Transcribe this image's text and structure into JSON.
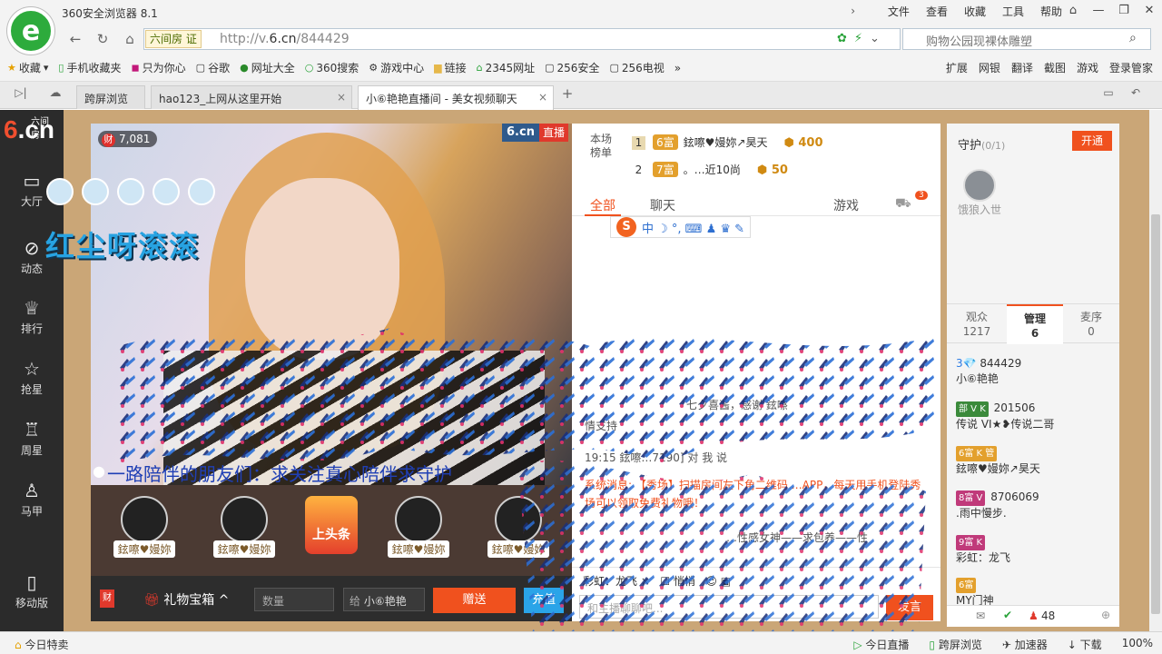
{
  "browser": {
    "app_title": "360安全浏览器 8.1",
    "menus": [
      "文件",
      "查看",
      "收藏",
      "工具",
      "帮助"
    ],
    "site_chip": "六间房 证",
    "url_prefix": "http://v.",
    "url_domain": "6.cn",
    "url_path": "/844429",
    "search_placeholder": "购物公园现裸体雕塑",
    "bookmarks": [
      "收藏",
      "手机收藏夹",
      "只为你心",
      "谷歌",
      "网址大全",
      "360搜索",
      "游戏中心",
      "链接",
      "2345网址",
      "256安全",
      "256电视"
    ],
    "bookmarks_right": [
      "扩展",
      "网银",
      "翻译",
      "截图",
      "游戏",
      "登录管家"
    ],
    "tabs": [
      "跨屏浏览",
      "hao123_上网从这里开始",
      "小⑥艳艳直播间 - 美女视频聊天"
    ]
  },
  "site": {
    "logo": "6.cn",
    "logo_small": "六间房",
    "nav": [
      "大厅",
      "动态",
      "排行",
      "抢星",
      "周星",
      "马甲",
      "移动版"
    ]
  },
  "video": {
    "rich_value": "7,081",
    "rich_badge": "财",
    "brand": "6.cn",
    "live": "直播",
    "overlay_name": "红尘呀滚滚",
    "scroll_message": "一路陪伴的朋友们：求关注真心陪伴求守护",
    "avatars": [
      "鉉嚓♥嫚妳",
      "鉉嚓♥嫚妳",
      "鉉嚓♥嫚妳",
      "鉉嚓♥嫚妳"
    ],
    "headline": "上头条"
  },
  "toolbar": {
    "rich": "财",
    "gift_box": "礼物宝箱",
    "qty_placeholder": "数量",
    "to_label": "给",
    "to_value": "小⑥艳艳",
    "send": "赠送",
    "charge": "充值"
  },
  "chat": {
    "rank_title": "本场榜单",
    "rank": [
      {
        "num": "1",
        "level": "6富",
        "name": "鉉嚓♥嫚妳↗昊天",
        "coins": "400"
      },
      {
        "num": "2",
        "level": "7富",
        "name": "。…近10尚",
        "coins": "50"
      }
    ],
    "tabs": [
      "全部",
      "聊天",
      "游戏"
    ],
    "badge": "3",
    "messages": [
      {
        "text": "七夕喜酱，感谢 鉉嚓"
      },
      {
        "text": "情支持"
      },
      {
        "text": "19:15  鉉嚓…7190] 对 我 说"
      }
    ],
    "system_msg": "系统消息: 【秀场】扫描房间左下角二维码 …APP，每天用手机登陆秀场可以领取免费礼物哦！",
    "bottom_msg": "…性感女神——求包养——性",
    "to": "彩虹：龙飞",
    "quiet": "悄悄",
    "input_placeholder": "和主播聊聊吧...",
    "send": "发言"
  },
  "guard": {
    "title": "守护",
    "count": "(0/1)",
    "open": "开通",
    "slot": "饿狼入世",
    "tabs": [
      {
        "label": "观众",
        "value": "1217"
      },
      {
        "label": "管理",
        "value": "6"
      },
      {
        "label": "麦序",
        "value": "0"
      }
    ],
    "users": [
      {
        "badge": "3💎",
        "id": "844429",
        "name": "小⑥艳艳"
      },
      {
        "badge": "部 V K",
        "id": "201506",
        "name": "传说 VI★❥传说二哥"
      },
      {
        "badge": "6富 K 管",
        "id": "",
        "name": "鉉嚓♥嫚妳↗昊天"
      },
      {
        "badge": "8富 V",
        "id": "8706069",
        "name": ".雨中慢步."
      },
      {
        "badge": "9富 K",
        "id": "",
        "name": "彩虹：龙飞"
      },
      {
        "badge": "6富",
        "id": "",
        "name": "MY门神"
      }
    ],
    "online": "48"
  },
  "status": {
    "left": "今日特卖",
    "right": [
      "今日直播",
      "跨屏浏览",
      "加速器",
      "下载",
      "100%"
    ]
  }
}
